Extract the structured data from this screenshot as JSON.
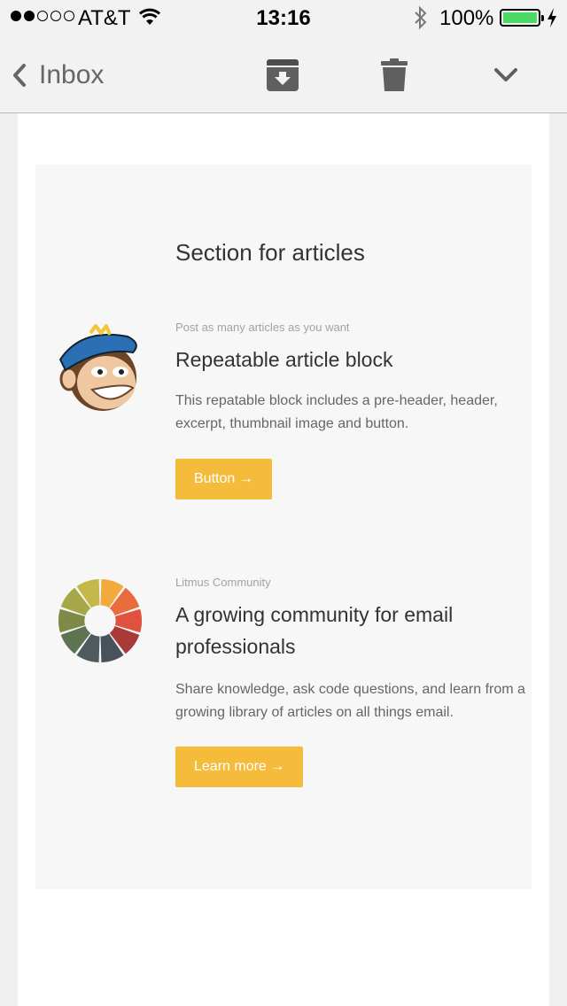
{
  "status_bar": {
    "carrier": "AT&T",
    "time": "13:16",
    "battery_percent": "100%",
    "battery_color": "#4cd964"
  },
  "nav": {
    "back_label": "Inbox",
    "icons": [
      "chevron-left-icon",
      "archive-icon",
      "trash-icon",
      "chevron-down-icon"
    ]
  },
  "section": {
    "title": "Section for articles"
  },
  "articles": [
    {
      "preheader": "Post as many articles as you want",
      "title": "Repeatable article block",
      "excerpt": "This repatable block includes a pre-header, header, excerpt, thumbnail image and button.",
      "button": "Button →",
      "thumbnail": "mailchimp-monkey"
    },
    {
      "preheader": "Litmus Community",
      "title": "A growing community for email professionals",
      "excerpt": "Share knowledge, ask code questions, and learn from a growing library of articles on all things email.",
      "button": "Learn more →",
      "thumbnail": "litmus-color-wheel"
    }
  ],
  "colors": {
    "button": "#f5bb3a",
    "section_bg": "#f7f7f7",
    "wheel": [
      "#f4a93e",
      "#ea6b3d",
      "#e0513f",
      "#a83a3a",
      "#48525a",
      "#4f5a5e",
      "#5d7352",
      "#7d8a48",
      "#a6a747",
      "#c5b84b"
    ]
  }
}
